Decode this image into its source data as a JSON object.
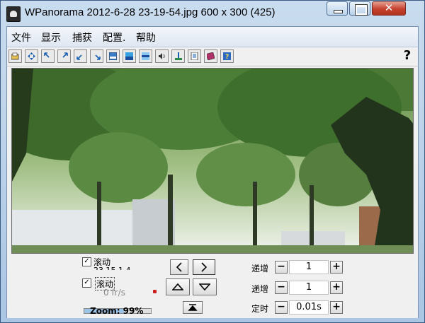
{
  "window": {
    "title": "WPanorama  2012-6-28 23-19-54.jpg   600 x 300 (425)",
    "close_glyph": "✕"
  },
  "menu": [
    "文件",
    "显示",
    "捕获",
    "配置.",
    "帮助"
  ],
  "toolbar": {
    "icons": [
      "open-icon",
      "move-icon",
      "scroll-left-icon",
      "scroll-right-icon",
      "scroll-down-left-icon",
      "scroll-down-right-icon",
      "image-view-icon",
      "landscape-icon",
      "horizon-icon",
      "sound-icon",
      "marker-icon",
      "notes-icon",
      "book-icon",
      "about-icon"
    ],
    "help": "?"
  },
  "controls": {
    "scroll_label_1": "滚动",
    "scroll_partial": "23 15 1 4",
    "scroll_label_2": "滚动",
    "fps": "0 fr/s",
    "zoom": "Zoom: 99%",
    "progress": 0.6,
    "row1": {
      "label": "递增",
      "value": "1"
    },
    "row2": {
      "label": "递增",
      "value": "1"
    },
    "row3": {
      "label": "定时",
      "value": "0.01s"
    },
    "minus": "−",
    "plus": "+",
    "check": "✓"
  },
  "colors": {
    "sky": "#f4f7f2",
    "foliage": "#3f6a2c",
    "ground": "#6f8f58"
  }
}
